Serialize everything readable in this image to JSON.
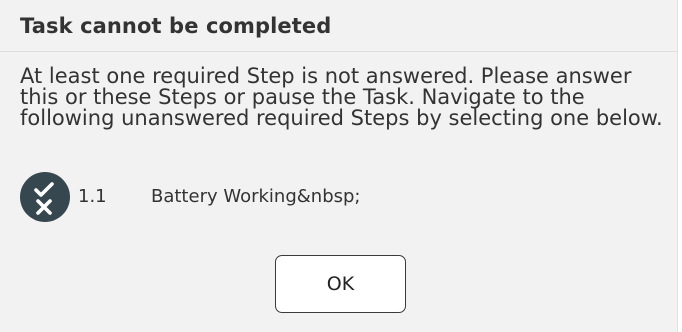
{
  "dialog": {
    "title": "Task cannot be completed",
    "message": "At least one required Step is not answered. Please answer this or these Steps or pause the Task. Navigate to the following unanswered required Steps by selecting one below.",
    "steps": [
      {
        "number": "1.1",
        "label": "Battery Working&nbsp;",
        "icon": "check-cross-icon"
      }
    ],
    "ok_label": "OK"
  },
  "colors": {
    "background": "#f2f2f2",
    "text": "#333333",
    "icon_circle": "#37474f",
    "button_border": "#3b3b3b"
  }
}
